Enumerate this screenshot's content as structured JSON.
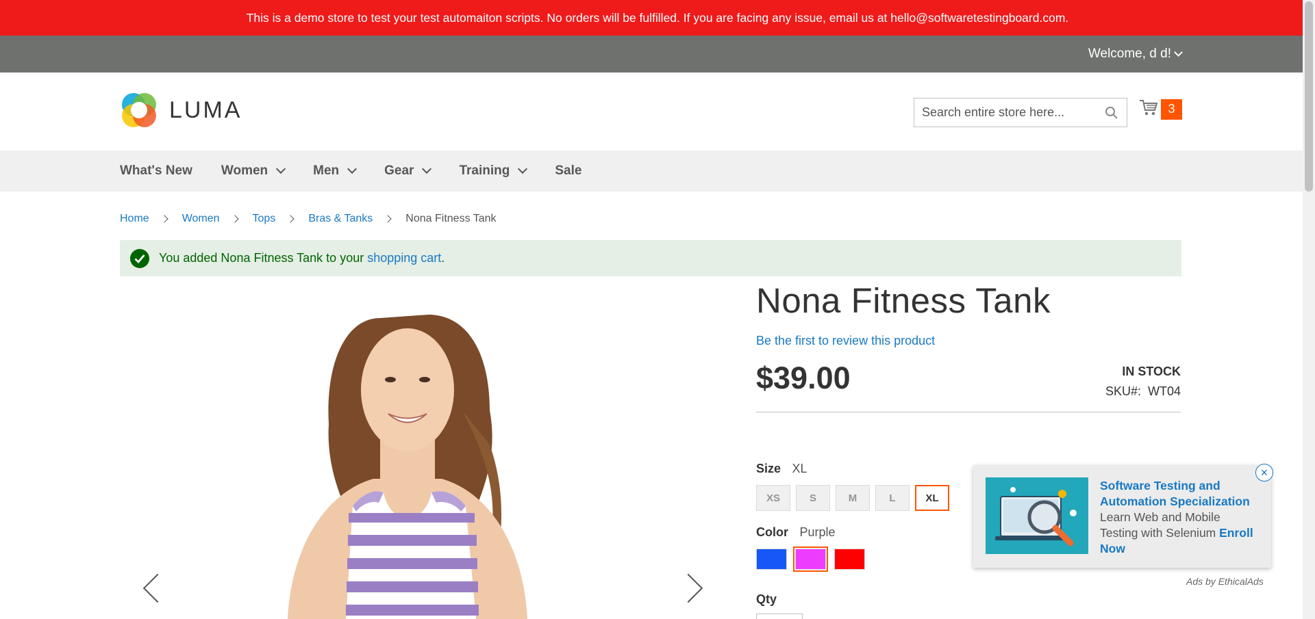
{
  "demo_notice": "This is a demo store to test your test automaiton scripts. No orders will be fulfilled. If you are facing any issue, email us at hello@softwaretestingboard.com.",
  "top_bar": {
    "welcome": "Welcome, d d!"
  },
  "header": {
    "logo_text": "LUMA",
    "search_placeholder": "Search entire store here...",
    "cart_count": "3"
  },
  "nav": {
    "items": [
      {
        "label": "What's New",
        "has_dropdown": false
      },
      {
        "label": "Women",
        "has_dropdown": true
      },
      {
        "label": "Men",
        "has_dropdown": true
      },
      {
        "label": "Gear",
        "has_dropdown": true
      },
      {
        "label": "Training",
        "has_dropdown": true
      },
      {
        "label": "Sale",
        "has_dropdown": false
      }
    ]
  },
  "breadcrumbs": [
    "Home",
    "Women",
    "Tops",
    "Bras & Tanks",
    "Nona Fitness Tank"
  ],
  "message": {
    "prefix": "You added Nona Fitness Tank to your ",
    "link": "shopping cart",
    "suffix": "."
  },
  "product": {
    "title": "Nona Fitness Tank",
    "review_link": "Be the first to review this product",
    "price": "$39.00",
    "stock": "IN STOCK",
    "sku_label": "SKU#:",
    "sku": "WT04",
    "size_label": "Size",
    "size_selected": "XL",
    "sizes": [
      "XS",
      "S",
      "M",
      "L",
      "XL"
    ],
    "color_label": "Color",
    "color_selected": "Purple",
    "colors": [
      "#1857f7",
      "#ef3dff",
      "#ff0000"
    ],
    "qty_label": "Qty"
  },
  "ad": {
    "title": "Software Testing and Automation Specialization",
    "body": "Learn Web and Mobile Testing with Selenium",
    "cta": "Enroll Now",
    "close": "×",
    "by": "Ads by EthicalAds"
  }
}
